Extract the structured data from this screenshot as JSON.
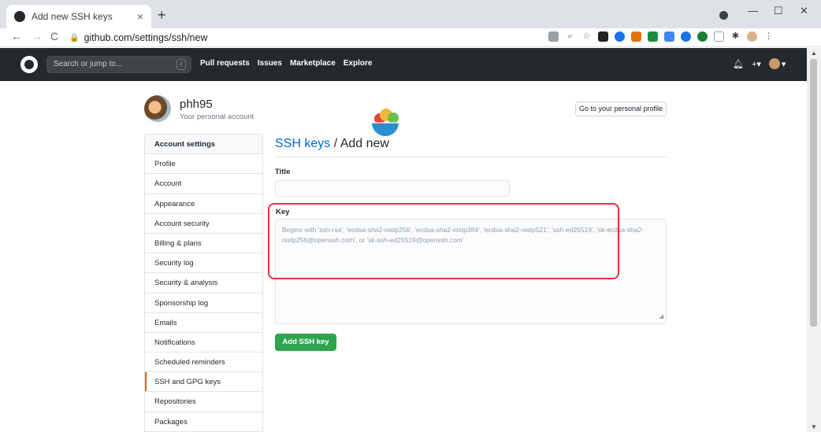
{
  "browser": {
    "tab_title": "Add new SSH keys",
    "close_glyph": "×",
    "new_tab_glyph": "+",
    "url": "github.com/settings/ssh/new",
    "nav": {
      "back": "←",
      "forward": "→",
      "reload": "C"
    },
    "window_controls": {
      "minimize": "—",
      "maximize": "☐",
      "close": "✕"
    }
  },
  "header": {
    "search_placeholder": "Search or jump to...",
    "search_shortcut": "/",
    "nav_items": [
      "Pull requests",
      "Issues",
      "Marketplace",
      "Explore"
    ],
    "bell_glyph": "🔔",
    "plus_label": "+▾",
    "avatar_caret": "▾"
  },
  "user": {
    "username": "phh95",
    "subtitle": "Your personal account",
    "profile_button": "Go to your personal profile"
  },
  "sidebar": {
    "items": [
      {
        "label": "Account settings",
        "kind": "head"
      },
      {
        "label": "Profile"
      },
      {
        "label": "Account"
      },
      {
        "label": "Appearance"
      },
      {
        "label": "Account security"
      },
      {
        "label": "Billing & plans"
      },
      {
        "label": "Security log"
      },
      {
        "label": "Security & analysis"
      },
      {
        "label": "Sponsorship log"
      },
      {
        "label": "Emails"
      },
      {
        "label": "Notifications"
      },
      {
        "label": "Scheduled reminders"
      },
      {
        "label": "SSH and GPG keys",
        "active": true
      },
      {
        "label": "Repositories"
      },
      {
        "label": "Packages"
      }
    ]
  },
  "form": {
    "heading_link": "SSH keys",
    "heading_rest": " / Add new",
    "title_label": "Title",
    "title_value": "",
    "key_label": "Key",
    "key_placeholder": "Begins with 'ssh-rsa', 'ecdsa-sha2-nistp256', 'ecdsa-sha2-nistp384', 'ecdsa-sha2-nistp521', 'ssh-ed25519', 'sk-ecdsa-sha2-nistp256@openssh.com', or 'sk-ssh-ed25519@openssh.com'",
    "submit_label": "Add SSH key"
  },
  "colors": {
    "header_bg": "#24292e",
    "link": "#0366d6",
    "primary_button": "#2ea44f",
    "highlight_box": "#e4343a",
    "active_tab_marker": "#e36209"
  }
}
